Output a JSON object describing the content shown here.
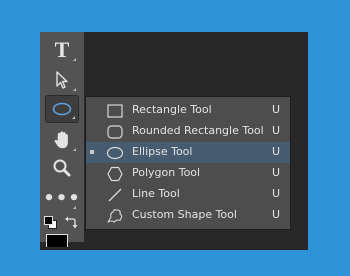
{
  "toolbar": {
    "tools": [
      {
        "name": "type-tool",
        "icon": "type-icon",
        "glyph": "T"
      },
      {
        "name": "path-selection-tool",
        "icon": "path-selection-arrow-icon"
      },
      {
        "name": "shape-tool",
        "icon": "ellipse-icon",
        "active": true
      },
      {
        "name": "hand-tool",
        "icon": "hand-icon"
      },
      {
        "name": "zoom-tool",
        "icon": "magnifier-icon"
      },
      {
        "name": "edit-toolbar",
        "icon": "more-dots-icon",
        "glyph": "•••"
      }
    ],
    "colors": {
      "foreground": "#000000",
      "background": "#ffffff"
    }
  },
  "flyout": {
    "items": [
      {
        "label": "Rectangle Tool",
        "shortcut": "U",
        "icon": "rectangle-icon",
        "selected": false
      },
      {
        "label": "Rounded Rectangle Tool",
        "shortcut": "U",
        "icon": "rounded-rectangle-icon",
        "selected": false
      },
      {
        "label": "Ellipse Tool",
        "shortcut": "U",
        "icon": "ellipse-icon",
        "selected": true
      },
      {
        "label": "Polygon Tool",
        "shortcut": "U",
        "icon": "polygon-icon",
        "selected": false
      },
      {
        "label": "Line Tool",
        "shortcut": "U",
        "icon": "line-icon",
        "selected": false
      },
      {
        "label": "Custom Shape Tool",
        "shortcut": "U",
        "icon": "custom-shape-icon",
        "selected": false
      }
    ]
  },
  "colors": {
    "page_background": "#2e93d6",
    "panel": "#535353",
    "menu": "#4d4d4d",
    "selection": "#465a70",
    "text": "#e3e3e3"
  }
}
